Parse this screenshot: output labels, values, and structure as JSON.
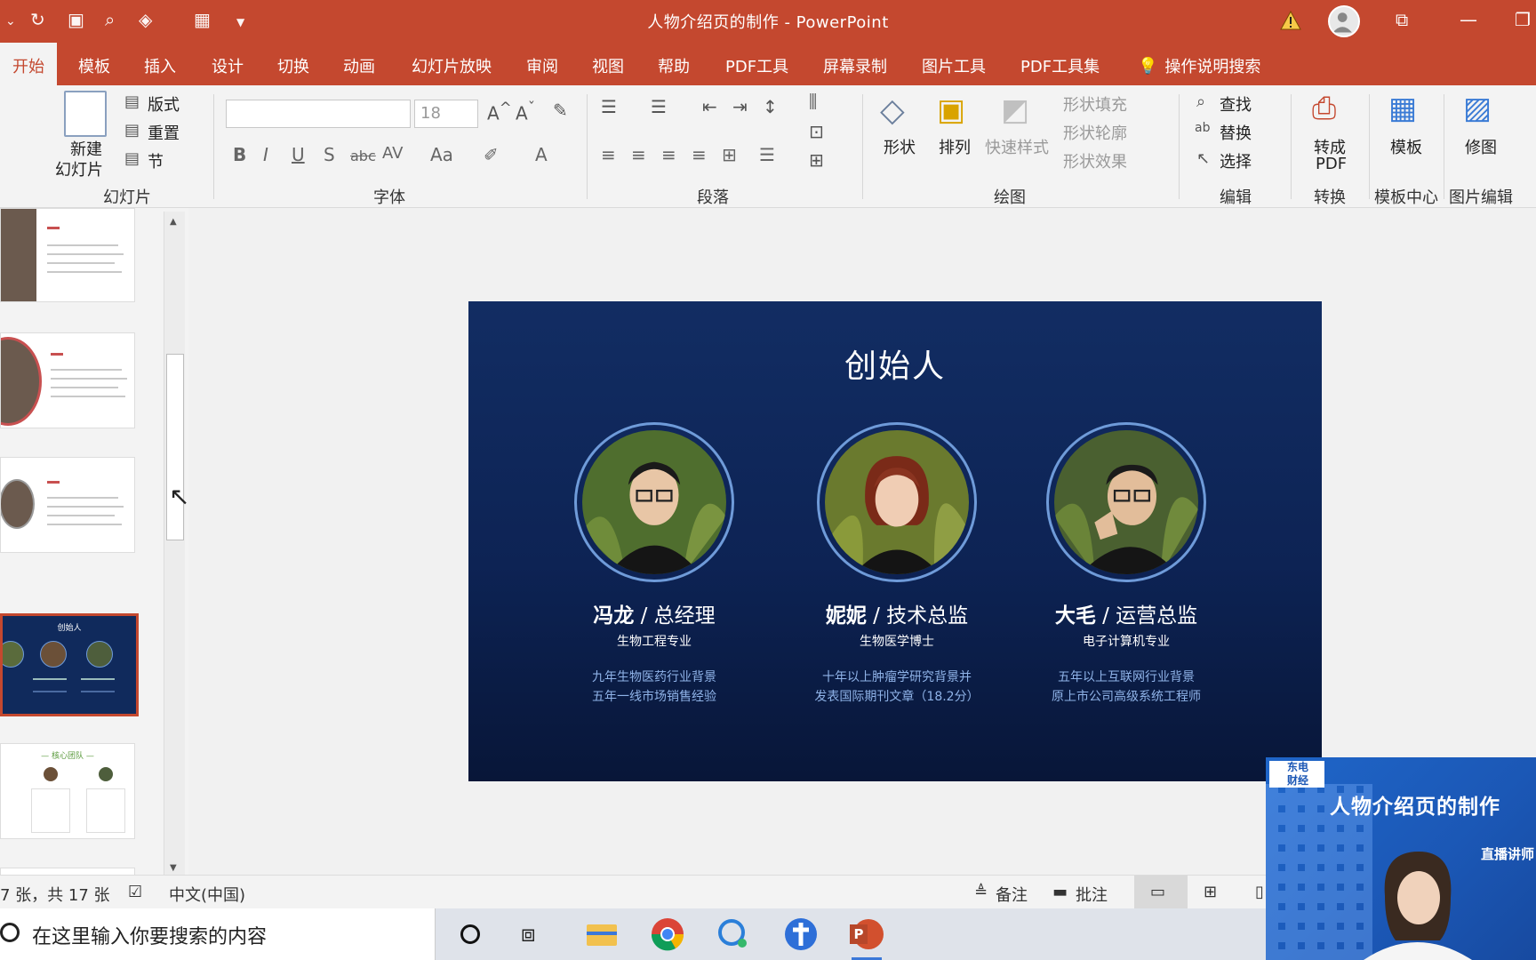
{
  "titlebar": {
    "doc_title": "人物介绍页的制作  -  PowerPoint"
  },
  "tabs": [
    {
      "label": "开始",
      "active": true
    },
    {
      "label": "模板"
    },
    {
      "label": "插入"
    },
    {
      "label": "设计"
    },
    {
      "label": "切换"
    },
    {
      "label": "动画"
    },
    {
      "label": "幻灯片放映"
    },
    {
      "label": "审阅"
    },
    {
      "label": "视图"
    },
    {
      "label": "帮助"
    },
    {
      "label": "PDF工具"
    },
    {
      "label": "屏幕录制"
    },
    {
      "label": "图片工具"
    },
    {
      "label": "PDF工具集"
    }
  ],
  "tell_me": "操作说明搜索",
  "ribbon": {
    "slides_group": {
      "label": "幻灯片",
      "new_slide": "新建",
      "new_slide_2": "幻灯片",
      "layout": "版式",
      "reset": "重置",
      "section": "节"
    },
    "font_group": {
      "label": "字体",
      "font_size": "18"
    },
    "paragraph_group": {
      "label": "段落"
    },
    "drawing_group": {
      "label": "绘图",
      "shapes": "形状",
      "arrange": "排列",
      "quick_styles": "快速样式",
      "shape_fill": "形状填充",
      "shape_outline": "形状轮廓",
      "shape_effects": "形状效果"
    },
    "editing_group": {
      "label": "编辑",
      "find": "查找",
      "replace": "替换",
      "select": "选择"
    },
    "convert_group": {
      "label": "转换",
      "to_pdf_1": "转成",
      "to_pdf_2": "PDF"
    },
    "template_group": {
      "label": "模板中心",
      "template": "模板"
    },
    "picture_group": {
      "label": "图片编辑",
      "retouch": "修图"
    }
  },
  "thumbnail_pane": {
    "section_label": "节",
    "thumb_titles": [
      "创始人",
      "— 核心团队 —"
    ]
  },
  "slide": {
    "title": "创始人",
    "people": [
      {
        "name": "冯龙",
        "role": " / 总经理",
        "major": "生物工程专业",
        "desc1": "九年生物医药行业背景",
        "desc2": "五年一线市场销售经验"
      },
      {
        "name": "妮妮",
        "role": " / 技术总监",
        "major": "生物医学博士",
        "desc1": "十年以上肿瘤学研究背景并",
        "desc2": "发表国际期刊文章（18.2分）"
      },
      {
        "name": "大毛",
        "role": " / 运营总监",
        "major": "电子计算机专业",
        "desc1": "五年以上互联网行业背景",
        "desc2": "原上市公司高级系统工程师"
      }
    ]
  },
  "statusbar": {
    "slide_count": "7 张，共 17 张",
    "language": "中文(中国)",
    "notes": "备注",
    "comments": "批注"
  },
  "taskbar": {
    "search_placeholder": "在这里输入你要搜索的内容"
  },
  "webcam": {
    "logo_1": "东电",
    "logo_2": "财经",
    "title": "人物介绍页的制作",
    "subtitle": "直播讲师"
  },
  "colors": {
    "accent": "#c4482f",
    "slide_bg": "#0d2354",
    "desc_text": "#8fb3e8"
  }
}
